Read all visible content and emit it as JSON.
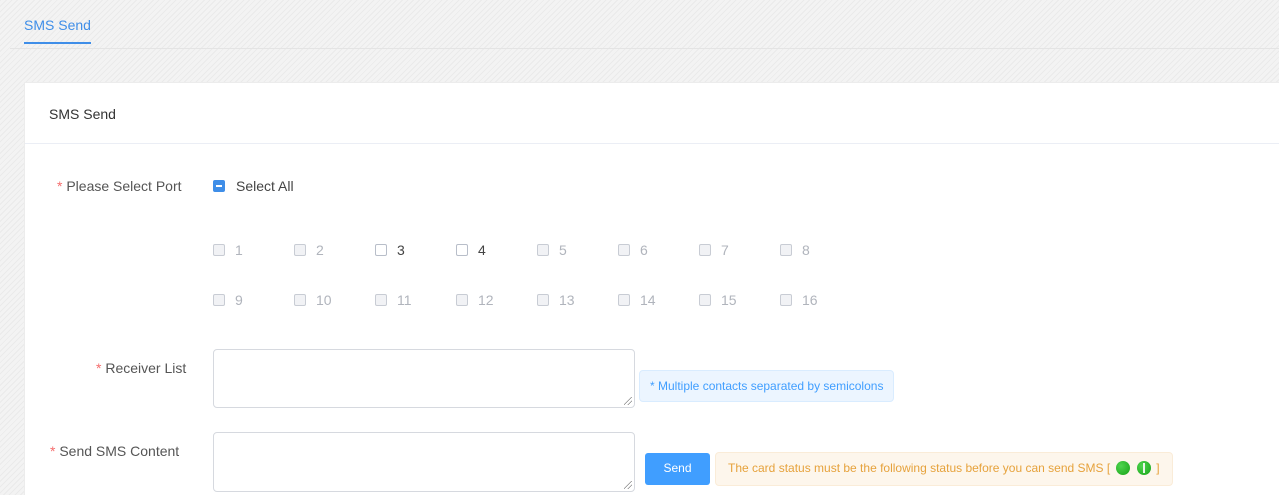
{
  "tabs": [
    {
      "label": "SMS Send",
      "active": true
    }
  ],
  "card": {
    "title": "SMS Send"
  },
  "form": {
    "port": {
      "required_mark": "*",
      "label": "Please Select Port",
      "select_all_label": "Select All",
      "select_all_state": "indeterminate",
      "ports": [
        {
          "label": "1",
          "enabled": false
        },
        {
          "label": "2",
          "enabled": false
        },
        {
          "label": "3",
          "enabled": true
        },
        {
          "label": "4",
          "enabled": true
        },
        {
          "label": "5",
          "enabled": false
        },
        {
          "label": "6",
          "enabled": false
        },
        {
          "label": "7",
          "enabled": false
        },
        {
          "label": "8",
          "enabled": false
        },
        {
          "label": "9",
          "enabled": false
        },
        {
          "label": "10",
          "enabled": false
        },
        {
          "label": "11",
          "enabled": false
        },
        {
          "label": "12",
          "enabled": false
        },
        {
          "label": "13",
          "enabled": false
        },
        {
          "label": "14",
          "enabled": false
        },
        {
          "label": "15",
          "enabled": false
        },
        {
          "label": "16",
          "enabled": false
        }
      ]
    },
    "receiver": {
      "required_mark": "*",
      "label": "Receiver List",
      "value": "",
      "hint": "* Multiple contacts separated by semicolons"
    },
    "content": {
      "required_mark": "*",
      "label": "Send SMS Content",
      "value": "",
      "send_label": "Send",
      "warning_prefix": "The card status must be the following status before you can send SMS [",
      "warning_suffix": "]",
      "status_icons": [
        "green-dot-icon",
        "green-signal-icon"
      ]
    }
  },
  "colors": {
    "accent": "#3f8ee8",
    "required": "#f56c6c",
    "hint_text": "#409eff",
    "warning_text": "#e6a23c",
    "status_green": "#16a316"
  }
}
